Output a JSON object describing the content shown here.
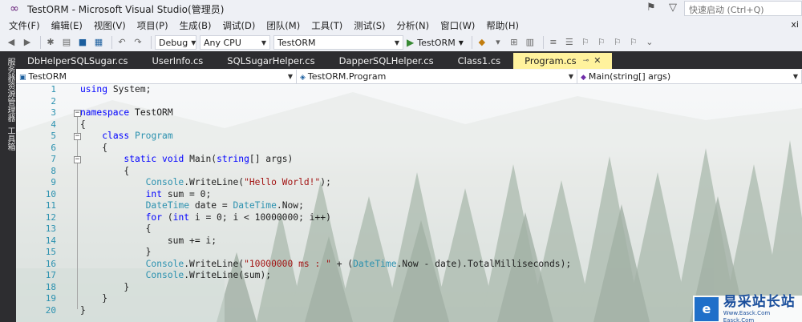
{
  "window": {
    "title": "TestORM - Microsoft Visual Studio(管理员)",
    "quick_launch_placeholder": "快速启动 (Ctrl+Q)",
    "user": "xi"
  },
  "menu": [
    "文件(F)",
    "编辑(E)",
    "视图(V)",
    "项目(P)",
    "生成(B)",
    "调试(D)",
    "团队(M)",
    "工具(T)",
    "测试(S)",
    "分析(N)",
    "窗口(W)",
    "帮助(H)"
  ],
  "toolbar": {
    "config": "Debug",
    "platform": "Any CPU",
    "startup_project": "TestORM",
    "start_label": "TestORM"
  },
  "side_panels": {
    "server_explorer": "服务器资源管理器",
    "toolbox": "工具箱"
  },
  "tabs": [
    {
      "label": "DbHelperSQLSugar.cs",
      "active": false
    },
    {
      "label": "UserInfo.cs",
      "active": false
    },
    {
      "label": "SQLSugarHelper.cs",
      "active": false
    },
    {
      "label": "DapperSQLHelper.cs",
      "active": false
    },
    {
      "label": "Class1.cs",
      "active": false
    },
    {
      "label": "Program.cs",
      "active": true
    }
  ],
  "navbar": {
    "project": "TestORM",
    "type": "TestORM.Program",
    "member": "Main(string[] args)"
  },
  "code": {
    "line_numbers": [
      "1",
      "2",
      "3",
      "4",
      "5",
      "6",
      "7",
      "8",
      "9",
      "10",
      "11",
      "12",
      "13",
      "14",
      "15",
      "16",
      "17",
      "18",
      "19",
      "20"
    ]
  },
  "watermark": {
    "title": "易采站长站",
    "url": "Www.Easck.Com  Easck.Com"
  }
}
